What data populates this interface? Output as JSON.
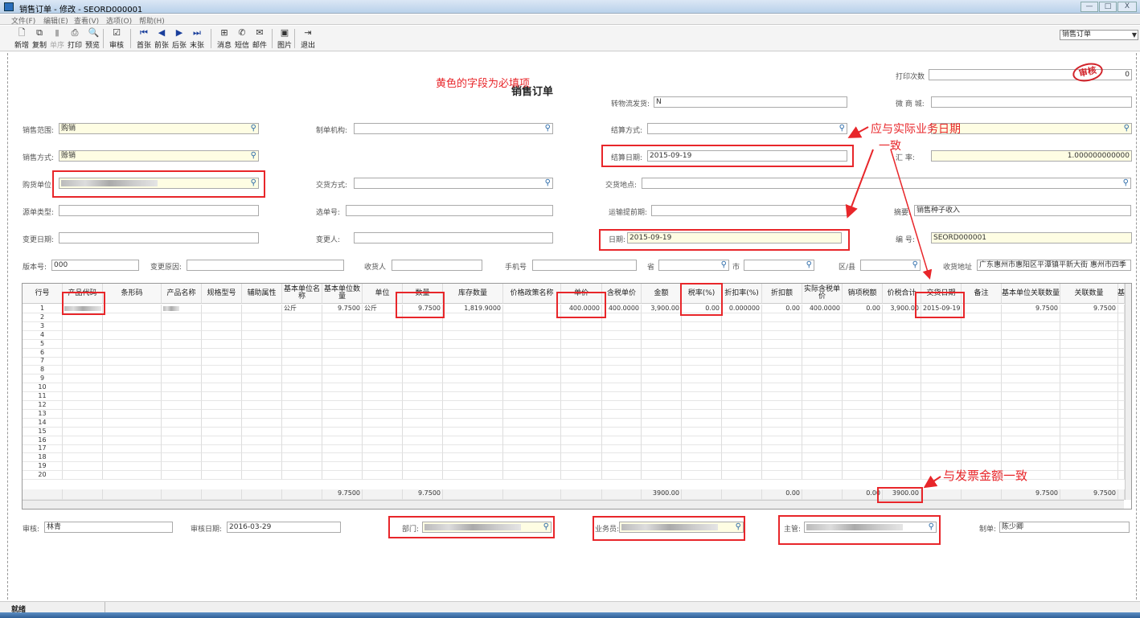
{
  "window": {
    "title": "销售订单 - 修改 - SEORD000001",
    "min": "—",
    "max": "□",
    "close": "X"
  },
  "menu": [
    "文件(F)",
    "编辑(E)",
    "查看(V)",
    "选项(O)",
    "帮助(H)"
  ],
  "toolbar": [
    {
      "label": "新增",
      "icon": "new-file-icon",
      "glyph": "🗋"
    },
    {
      "label": "复制",
      "icon": "copy-icon",
      "glyph": "⧉"
    },
    {
      "label": "单序",
      "icon": "sort-icon",
      "glyph": "▮",
      "disabled": true
    },
    {
      "label": "打印",
      "icon": "print-icon",
      "glyph": "⎙"
    },
    {
      "label": "预览",
      "icon": "preview-icon",
      "glyph": "🔍"
    },
    {
      "label": "审核",
      "icon": "audit-icon",
      "glyph": "☑"
    },
    {
      "label": "首张",
      "icon": "first-icon",
      "glyph": "⏮",
      "nav": true
    },
    {
      "label": "前张",
      "icon": "prev-icon",
      "glyph": "◀",
      "nav": true
    },
    {
      "label": "后张",
      "icon": "next-icon",
      "glyph": "▶",
      "nav": true
    },
    {
      "label": "末张",
      "icon": "last-icon",
      "glyph": "⏭",
      "nav": true
    },
    {
      "label": "消息",
      "icon": "message-icon",
      "glyph": "⊞"
    },
    {
      "label": "短信",
      "icon": "sms-icon",
      "glyph": "✆"
    },
    {
      "label": "邮件",
      "icon": "mail-icon",
      "glyph": "✉"
    },
    {
      "label": "图片",
      "icon": "image-icon",
      "glyph": "▣"
    },
    {
      "label": "退出",
      "icon": "exit-icon",
      "glyph": "⇥"
    }
  ],
  "bill_type": "销售订单",
  "form": {
    "title": "销售订单",
    "required_note": "黄色的字段为必填项",
    "stamp": "审核",
    "print_count": {
      "label": "打印次数",
      "value": "0"
    },
    "logistics": {
      "label": "转物流发货:",
      "value": "N"
    },
    "wechat_mall": {
      "label": "微 商 城:",
      "value": ""
    },
    "sales_scope": {
      "label": "销售范围:",
      "value": "购销"
    },
    "org": {
      "label": "制单机构:",
      "value": ""
    },
    "settle_method": {
      "label": "结算方式:",
      "value": ""
    },
    "sales_method": {
      "label": "销售方式:",
      "value": "赊销"
    },
    "settle_date": {
      "label": "结算日期:",
      "value": "2015-09-19"
    },
    "rate": {
      "label": "汇   率:",
      "value": "1.000000000000"
    },
    "customer": {
      "label": "购货单位:",
      "value": ""
    },
    "delivery_method": {
      "label": "交货方式:",
      "value": ""
    },
    "delivery_place": {
      "label": "交货地点:",
      "value": ""
    },
    "source_type": {
      "label": "源单类型:",
      "value": ""
    },
    "select_no": {
      "label": "选单号:",
      "value": ""
    },
    "lead_time": {
      "label": "运输提前期:",
      "value": ""
    },
    "summary": {
      "label": "摘要:",
      "value": "销售种子收入"
    },
    "change_date": {
      "label": "变更日期:",
      "value": ""
    },
    "changer": {
      "label": "变更人:",
      "value": ""
    },
    "date": {
      "label": "日期:",
      "value": "2015-09-19"
    },
    "number": {
      "label": "编   号:",
      "value": "SEORD000001"
    },
    "version": {
      "label": "版本号:",
      "value": "000"
    },
    "change_reason": {
      "label": "变更原因:",
      "value": ""
    },
    "receiver": {
      "label": "收货人",
      "value": ""
    },
    "phone": {
      "label": "手机号",
      "value": ""
    },
    "province": {
      "label": "省",
      "value": ""
    },
    "city": {
      "label": "市",
      "value": ""
    },
    "district": {
      "label": "区/县",
      "value": ""
    },
    "address": {
      "label": "收货地址",
      "value": "广东惠州市惠阳区平潭镇平新大街   惠州市四季"
    }
  },
  "grid": {
    "columns": [
      "行号",
      "产品代码",
      "条形码",
      "产品名称",
      "规格型号",
      "辅助属性",
      "基本单位名称",
      "基本单位数量",
      "单位",
      "数量",
      "库存数量",
      "价格政策名称",
      "单价",
      "含税单价",
      "金额",
      "税率(%)",
      "折扣率(%)",
      "折扣额",
      "实际含税单价",
      "销项税额",
      "价税合计",
      "交货日期",
      "备注",
      "基本单位关联数量",
      "关联数量",
      "基"
    ],
    "row1": [
      "1",
      "",
      "",
      "",
      "",
      "",
      "公斤",
      "9.7500",
      "公斤",
      "9.7500",
      "1,819.9000",
      "",
      "400.0000",
      "400.0000",
      "3,900.00",
      "0.00",
      "0.000000",
      "0.00",
      "400.0000",
      "0.00",
      "3,900.00",
      "2015-09-19",
      "",
      "9.7500",
      "9.7500",
      ""
    ],
    "row_count": 20,
    "totals": [
      "",
      "",
      "",
      "",
      "",
      "",
      "",
      "9.7500",
      "",
      "9.7500",
      "",
      "",
      "",
      "",
      "3900.00",
      "",
      "",
      "0.00",
      "",
      "0.00",
      "3900.00",
      "",
      "",
      "9.7500",
      "9.7500",
      ""
    ]
  },
  "footer": {
    "auditor": {
      "label": "审核:",
      "value": "林青"
    },
    "audit_date": {
      "label": "审核日期:",
      "value": "2016-03-29"
    },
    "dept": {
      "label": "部门:",
      "value": ""
    },
    "salesman": {
      "label": "业务员:",
      "value": ""
    },
    "manager": {
      "label": "主管:",
      "value": ""
    },
    "maker": {
      "label": "制单:",
      "value": "陈少卿"
    }
  },
  "annotations": {
    "date_note_1": "应与实际业务日期",
    "date_note_2": "一致",
    "invoice_note": "与发票金额一致"
  },
  "status": "就绪",
  "colors": {
    "required": "#fefde3",
    "annotation": "#e8262a"
  }
}
